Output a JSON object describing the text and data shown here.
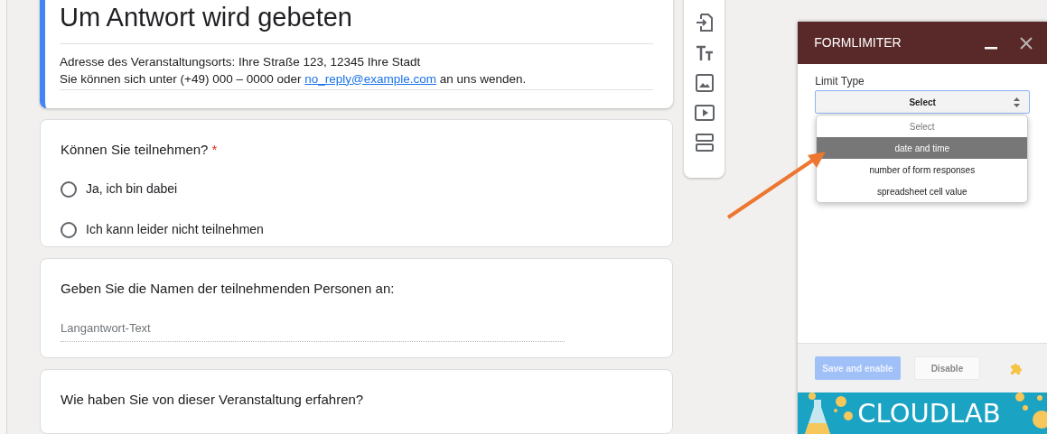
{
  "form": {
    "title": "Um Antwort wird gebeten",
    "address": "Adresse des Veranstaltungsorts: Ihre Straße 123, 12345 Ihre Stadt",
    "contact_before": "Sie können sich unter (+49) 000 – 0000 oder",
    "contact_link": "no_reply@example.com",
    "contact_after": "an uns wenden.",
    "questions": [
      {
        "kind": "radio",
        "text": "Können Sie teilnehmen?",
        "required_mark": "*",
        "options": [
          {
            "label": "Ja, ich bin dabei",
            "selected": false
          },
          {
            "label": "Ich kann leider nicht teilnehmen",
            "selected": false
          }
        ]
      },
      {
        "kind": "long_text",
        "text": "Geben Sie die Namen der teilnehmenden Personen an:",
        "placeholder": "Langantwort-Text"
      },
      {
        "kind": "cut",
        "text": "Wie haben Sie von dieser Veranstaltung erfahren?"
      }
    ]
  },
  "panel": {
    "title": "FORMLIMITER",
    "field_label": "Limit Type",
    "select_value": "Select",
    "options": [
      {
        "label": "Select",
        "disabled": true,
        "selected": false
      },
      {
        "label": "date and time",
        "disabled": false,
        "selected": true
      },
      {
        "label": "number of form responses",
        "disabled": false,
        "selected": false
      },
      {
        "label": "spreadsheet cell value",
        "disabled": false,
        "selected": false
      }
    ],
    "buttons": [
      {
        "label": "Save and enable",
        "kind": "primary",
        "disabled": true
      },
      {
        "label": "Disable",
        "kind": "secondary",
        "disabled": false
      }
    ],
    "banner": "CLOUDLAB"
  }
}
